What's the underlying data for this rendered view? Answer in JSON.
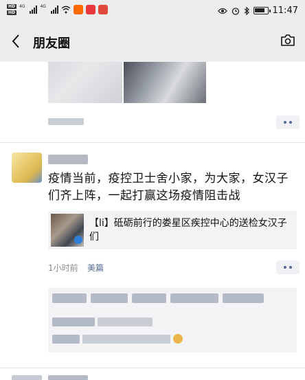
{
  "status_bar": {
    "badges": [
      "HD",
      "HD"
    ],
    "network": [
      "4G",
      "4G"
    ],
    "time": "11:47",
    "app_icon_colors": [
      "#ff6a00",
      "#e8393c",
      "#e14a3b"
    ]
  },
  "nav": {
    "back_icon": "chevron-left-icon",
    "title": "朋友圈",
    "camera_icon": "camera-icon"
  },
  "post": {
    "text": "疫情当前，疫控卫士舍小家，为大家，女汉子们齐上阵，一起打赢这场疫情阻击战",
    "share_title": "【li】砥砺前行的娄星区疾控中心的送检女汉子们",
    "time": "1小时前",
    "source": "美篇"
  },
  "colors": {
    "link": "#576b95",
    "nav_bg": "#ededed",
    "comment_bg": "#f3f3f5"
  }
}
